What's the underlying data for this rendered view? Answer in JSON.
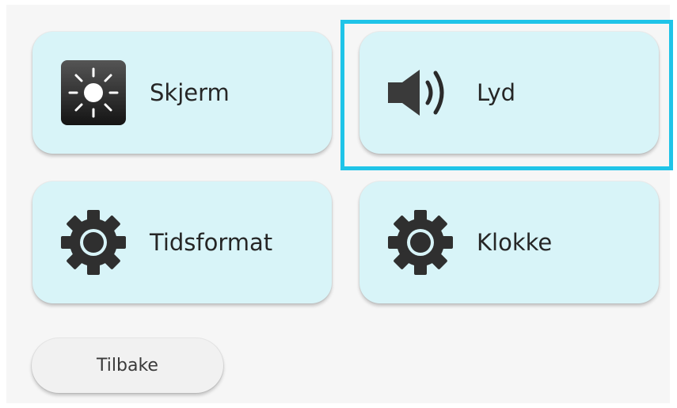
{
  "menu": {
    "items": [
      {
        "label": "Skjerm",
        "icon": "brightness-icon"
      },
      {
        "label": "Lyd",
        "icon": "speaker-icon"
      },
      {
        "label": "Tidsformat",
        "icon": "gear-icon"
      },
      {
        "label": "Klokke",
        "icon": "gear-icon"
      }
    ],
    "selected": "Lyd"
  },
  "back_label": "Tilbake",
  "colors": {
    "tile_background": "#d8f4f8",
    "focus_outline": "#1fc4e8",
    "page_background": "#f6f6f6"
  }
}
